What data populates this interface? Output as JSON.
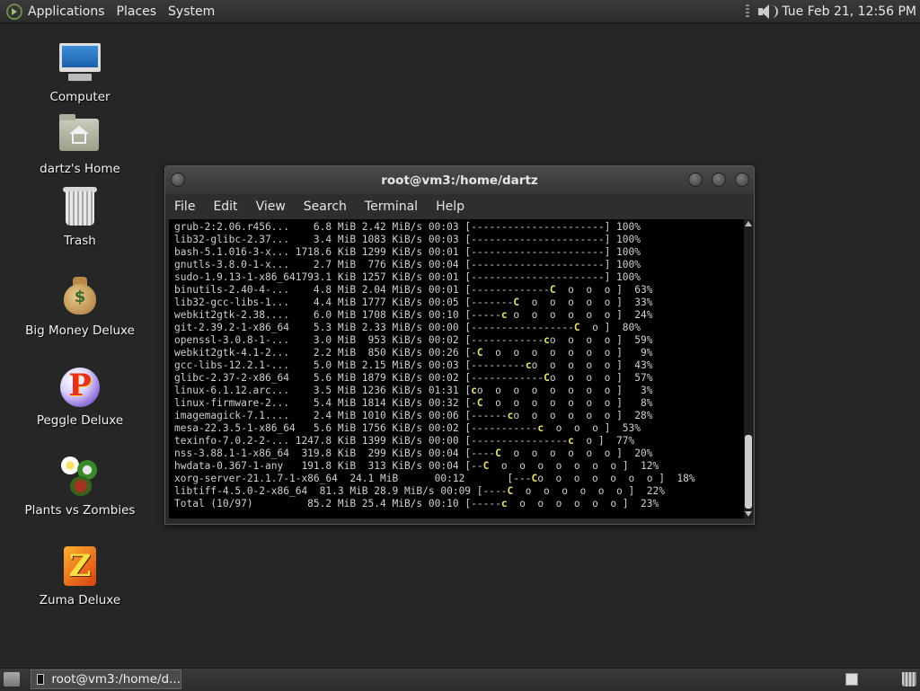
{
  "top_panel": {
    "menus": [
      "Applications",
      "Places",
      "System"
    ],
    "clock": "Tue Feb 21, 12:56 PM",
    "icons": {
      "logo": "distro-logo-icon",
      "volume": "speaker-icon"
    }
  },
  "desktop": {
    "icons": [
      {
        "label": "Computer",
        "icon": "computer-icon"
      },
      {
        "label": "dartz's Home",
        "icon": "home-folder-icon"
      },
      {
        "label": "Trash",
        "icon": "trash-icon"
      },
      {
        "label": "Big Money Deluxe",
        "icon": "money-bag-icon"
      },
      {
        "label": "Peggle Deluxe",
        "icon": "peggle-icon"
      },
      {
        "label": "Plants vs Zombies",
        "icon": "plants-icon"
      },
      {
        "label": "Zuma Deluxe",
        "icon": "zuma-icon"
      }
    ]
  },
  "terminal": {
    "title": "root@vm3:/home/dartz",
    "menu": [
      "File",
      "Edit",
      "View",
      "Search",
      "Terminal",
      "Help"
    ],
    "lines": [
      {
        "name": "grub-2:2.06.r456...",
        "size": "6.8 MiB",
        "rate": "2.42 MiB/s",
        "time": "00:03",
        "bar": "[----------------------]",
        "pct": "100%"
      },
      {
        "name": "lib32-glibc-2.37...",
        "size": "3.4 MiB",
        "rate": "1083 KiB/s",
        "time": "00:03",
        "bar": "[----------------------]",
        "pct": "100%"
      },
      {
        "name": "bash-5.1.016-3-x...",
        "size": "1718.6 KiB",
        "rate": "1299 KiB/s",
        "time": "00:01",
        "bar": "[----------------------]",
        "pct": "100%"
      },
      {
        "name": "gnutls-3.8.0-1-x...",
        "size": "2.7 MiB",
        "rate": "776 KiB/s",
        "time": "00:04",
        "bar": "[----------------------]",
        "pct": "100%"
      },
      {
        "name": "sudo-1.9.13-1-x86_64",
        "size": "1793.1 KiB",
        "rate": "1257 KiB/s",
        "time": "00:01",
        "bar": "[----------------------]",
        "pct": "100%"
      },
      {
        "name": "binutils-2.40-4-...",
        "size": "4.8 MiB",
        "rate": "2.04 MiB/s",
        "time": "00:01",
        "bar": "[-------------C  o  o  o ]",
        "pct": "63%"
      },
      {
        "name": "lib32-gcc-libs-1...",
        "size": "4.4 MiB",
        "rate": "1777 KiB/s",
        "time": "00:05",
        "bar": "[-------C  o  o  o  o  o ]",
        "pct": "33%"
      },
      {
        "name": "webkit2gtk-2.38....",
        "size": "6.0 MiB",
        "rate": "1708 KiB/s",
        "time": "00:10",
        "bar": "[-----c o  o  o  o  o  o ]",
        "pct": "24%"
      },
      {
        "name": "git-2.39.2-1-x86_64",
        "size": "5.3 MiB",
        "rate": "2.33 MiB/s",
        "time": "00:00",
        "bar": "[-----------------C  o ]",
        "pct": "80%"
      },
      {
        "name": "openssl-3.0.8-1-...",
        "size": "3.0 MiB",
        "rate": "953 KiB/s",
        "time": "00:02",
        "bar": "[------------co  o  o  o ]",
        "pct": "59%"
      },
      {
        "name": "webkit2gtk-4.1-2...",
        "size": "2.2 MiB",
        "rate": "850 KiB/s",
        "time": "00:26",
        "bar": "[-C  o  o  o  o  o  o  o ]",
        "pct": "9%"
      },
      {
        "name": "gcc-libs-12.2.1-...",
        "size": "5.0 MiB",
        "rate": "2.15 MiB/s",
        "time": "00:03",
        "bar": "[---------co  o  o  o  o ]",
        "pct": "43%"
      },
      {
        "name": "glibc-2.37-2-x86_64",
        "size": "5.6 MiB",
        "rate": "1879 KiB/s",
        "time": "00:02",
        "bar": "[------------Co  o  o  o ]",
        "pct": "57%"
      },
      {
        "name": "linux-6.1.12.arc...",
        "size": "3.5 MiB",
        "rate": "1236 KiB/s",
        "time": "01:31",
        "bar": "[co  o  o  o  o  o  o  o ]",
        "pct": "3%"
      },
      {
        "name": "linux-firmware-2...",
        "size": "5.4 MiB",
        "rate": "1814 KiB/s",
        "time": "00:32",
        "bar": "[-C  o  o  o  o  o  o  o ]",
        "pct": "8%"
      },
      {
        "name": "imagemagick-7.1....",
        "size": "2.4 MiB",
        "rate": "1010 KiB/s",
        "time": "00:06",
        "bar": "[------co  o  o  o  o  o ]",
        "pct": "28%"
      },
      {
        "name": "mesa-22.3.5-1-x86_64",
        "size": "5.6 MiB",
        "rate": "1756 KiB/s",
        "time": "00:02",
        "bar": "[-----------c  o  o  o ]",
        "pct": "53%"
      },
      {
        "name": "texinfo-7.0.2-2-...",
        "size": "1247.8 KiB",
        "rate": "1399 KiB/s",
        "time": "00:00",
        "bar": "[----------------c  o ]",
        "pct": "77%"
      },
      {
        "name": "nss-3.88.1-1-x86_64",
        "size": "319.8 KiB",
        "rate": "299 KiB/s",
        "time": "00:04",
        "bar": "[----C  o  o  o  o  o  o ]",
        "pct": "20%"
      },
      {
        "name": "hwdata-0.367-1-any",
        "size": "191.8 KiB",
        "rate": "313 KiB/s",
        "time": "00:04",
        "bar": "[--C  o  o  o  o  o  o  o ]",
        "pct": "12%"
      },
      {
        "name": "xorg-server-21.1.7-1-x86_64",
        "size": "24.1 MiB",
        "rate": "00:12",
        "time": "",
        "bar": "[---Co  o  o  o  o  o  o ]",
        "pct": "18%"
      },
      {
        "name": "libtiff-4.5.0-2-x86_64",
        "size": "81.3 MiB",
        "rate": "28.9 MiB/s",
        "time": "00:09",
        "bar": "[----C  o  o  o  o  o  o ]",
        "pct": "22%"
      },
      {
        "name": "Total (10/97)",
        "size": "85.2 MiB",
        "rate": "25.4 MiB/s",
        "time": "00:10",
        "bar": "[-----c  o  o  o  o  o  o ]",
        "pct": "23%"
      }
    ]
  },
  "taskbar": {
    "task_label": "root@vm3:/home/d...",
    "icons": {
      "show_desktop": "show-desktop-icon",
      "terminal": "terminal-icon",
      "workspace": "workspace-switcher-icon",
      "trash": "trash-icon"
    }
  },
  "colors": {
    "desktop_bg": "#262626",
    "terminal_bg": "#000000",
    "pacman": "#e8e070"
  }
}
